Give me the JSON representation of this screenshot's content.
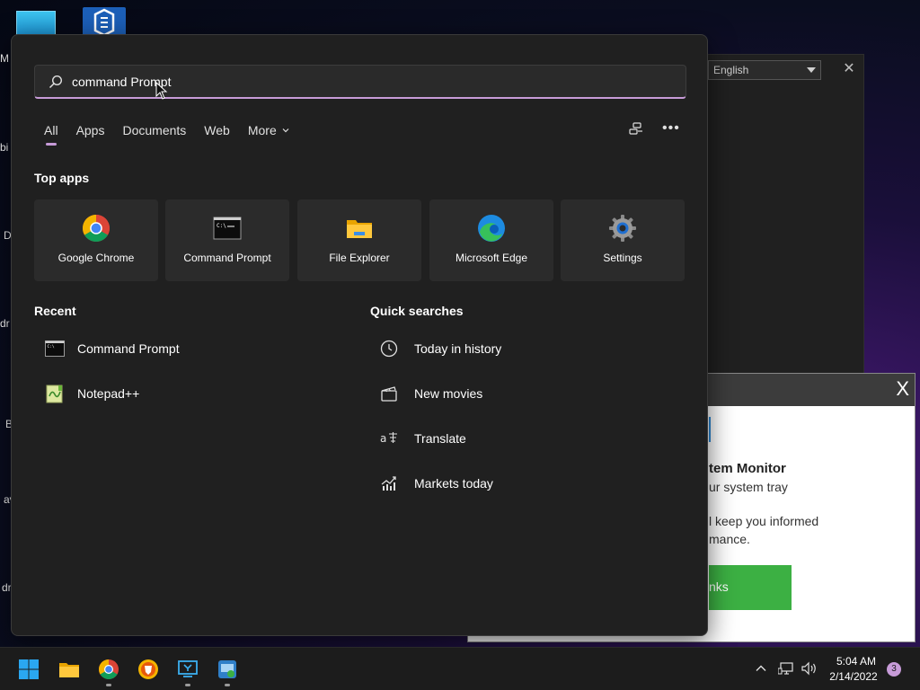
{
  "desktop": {
    "labels": [
      "M",
      "bi",
      "D",
      "dr",
      "B",
      "av",
      "dr"
    ]
  },
  "background_window": {
    "language_value": "English"
  },
  "monitor_popup": {
    "close_label": "X",
    "title_fragment": "tem Monitor",
    "subtitle_fragment": "ur system tray",
    "body_line1_fragment": "l keep you informed",
    "body_line2_fragment": "mance.",
    "button_fragment": "nks",
    "button_color": "#3cb043"
  },
  "search": {
    "query": "command Prompt",
    "accent_color": "#c79bd8"
  },
  "tabs": [
    {
      "label": "All",
      "active": true
    },
    {
      "label": "Apps"
    },
    {
      "label": "Documents"
    },
    {
      "label": "Web"
    },
    {
      "label": "More"
    }
  ],
  "sections": {
    "top_apps": "Top apps",
    "recent": "Recent",
    "quick_searches": "Quick searches"
  },
  "top_apps": [
    {
      "label": "Google Chrome",
      "icon": "chrome-icon"
    },
    {
      "label": "Command Prompt",
      "icon": "cmd-icon"
    },
    {
      "label": "File Explorer",
      "icon": "folder-icon"
    },
    {
      "label": "Microsoft Edge",
      "icon": "edge-icon"
    },
    {
      "label": "Settings",
      "icon": "gear-icon"
    }
  ],
  "recent": [
    {
      "label": "Command Prompt",
      "icon": "cmd-icon"
    },
    {
      "label": "Notepad++",
      "icon": "notepad-icon"
    }
  ],
  "quick_searches": [
    {
      "label": "Today in history",
      "icon": "clock-icon"
    },
    {
      "label": "New movies",
      "icon": "clapperboard-icon"
    },
    {
      "label": "Translate",
      "icon": "translate-icon"
    },
    {
      "label": "Markets today",
      "icon": "chart-icon"
    }
  ],
  "taskbar": {
    "time": "5:04 AM",
    "date": "2/14/2022",
    "notification_count": "3"
  }
}
